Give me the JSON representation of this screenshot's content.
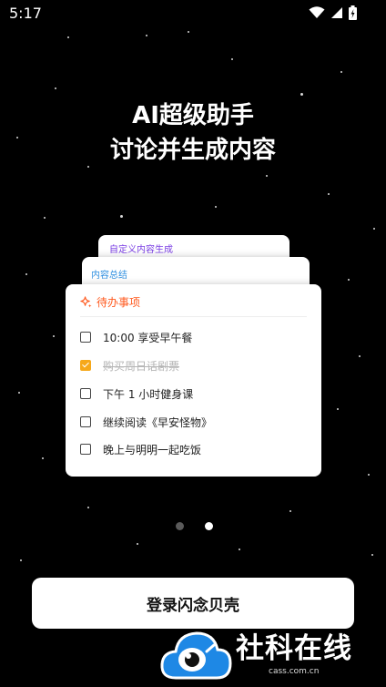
{
  "status_bar": {
    "time": "5:17"
  },
  "headline": {
    "line1": "AI超级助手",
    "line2": "讨论并生成内容"
  },
  "cards": {
    "back2_title": "自定义内容生成",
    "back1_title": "内容总结",
    "main_title": "待办事项"
  },
  "todo_items": [
    {
      "text": "10:00 享受早午餐",
      "checked": false
    },
    {
      "text": "购买周日话剧票",
      "checked": true
    },
    {
      "text": "下午 1 小时健身课",
      "checked": false
    },
    {
      "text": "继续阅读《早安怪物》",
      "checked": false
    },
    {
      "text": "晚上与明明一起吃饭",
      "checked": false
    }
  ],
  "pager": {
    "count": 2,
    "active_index": 1
  },
  "login_button": {
    "label": "登录闪念贝壳"
  },
  "watermark": {
    "text": "社科在线",
    "url": "cass.com.cn",
    "color": "#1e88e5"
  },
  "colors": {
    "accent_orange": "#ff5a1f",
    "checkbox_checked": "#f6a81a",
    "purple": "#7b3fe4",
    "blue": "#2f8fe0"
  }
}
